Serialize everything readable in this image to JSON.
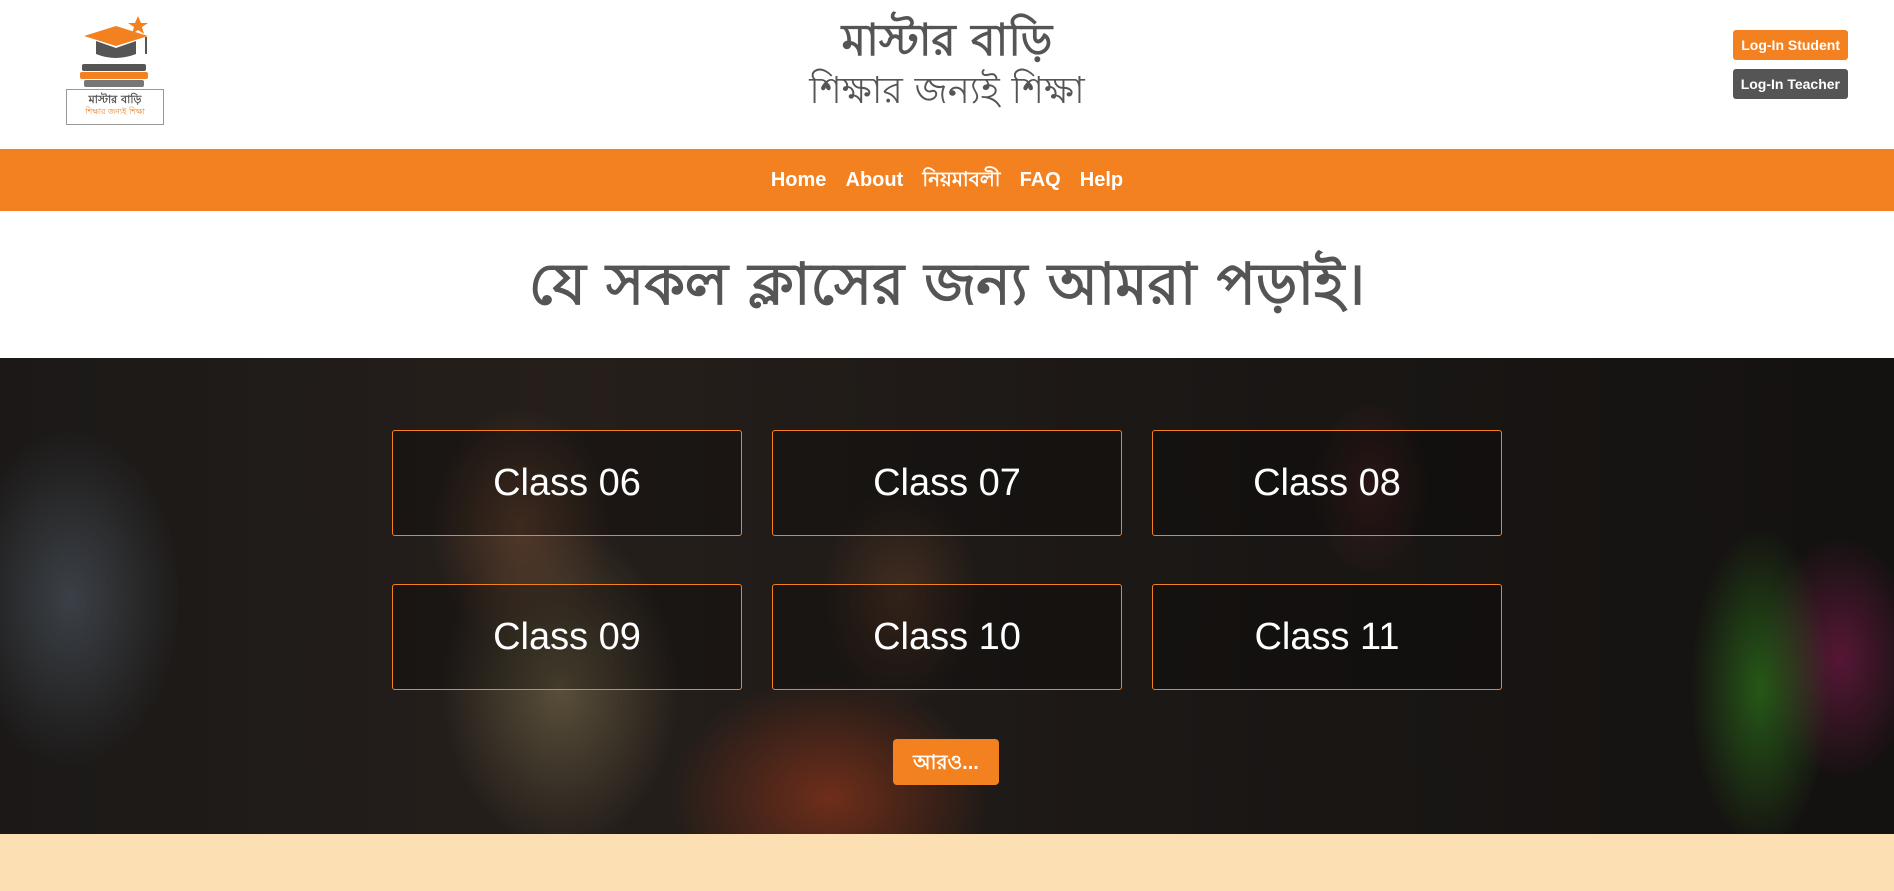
{
  "header": {
    "logo": {
      "title": "মাস্টার বাড়ি",
      "tagline": "শিক্ষার জন্যই শিক্ষা"
    },
    "title": "মাস্টার বাড়ি",
    "tagline": "শিক্ষার জন্যই শিক্ষা",
    "login_student": "Log-In Student",
    "login_teacher": "Log-In Teacher"
  },
  "nav": {
    "items": [
      {
        "label": "Home"
      },
      {
        "label": "About"
      },
      {
        "label": "নিয়মাবলী"
      },
      {
        "label": "FAQ"
      },
      {
        "label": "Help"
      }
    ]
  },
  "section": {
    "title": "যে সকল ক্লাসের জন্য আমরা পড়াই।"
  },
  "classes": [
    {
      "label": "Class 06"
    },
    {
      "label": "Class 07"
    },
    {
      "label": "Class 08"
    },
    {
      "label": "Class 09"
    },
    {
      "label": "Class 10"
    },
    {
      "label": "Class 11"
    }
  ],
  "more_button": "আরও...",
  "colors": {
    "accent": "#f4811f",
    "dark": "#555555",
    "band": "#fce0b3"
  }
}
